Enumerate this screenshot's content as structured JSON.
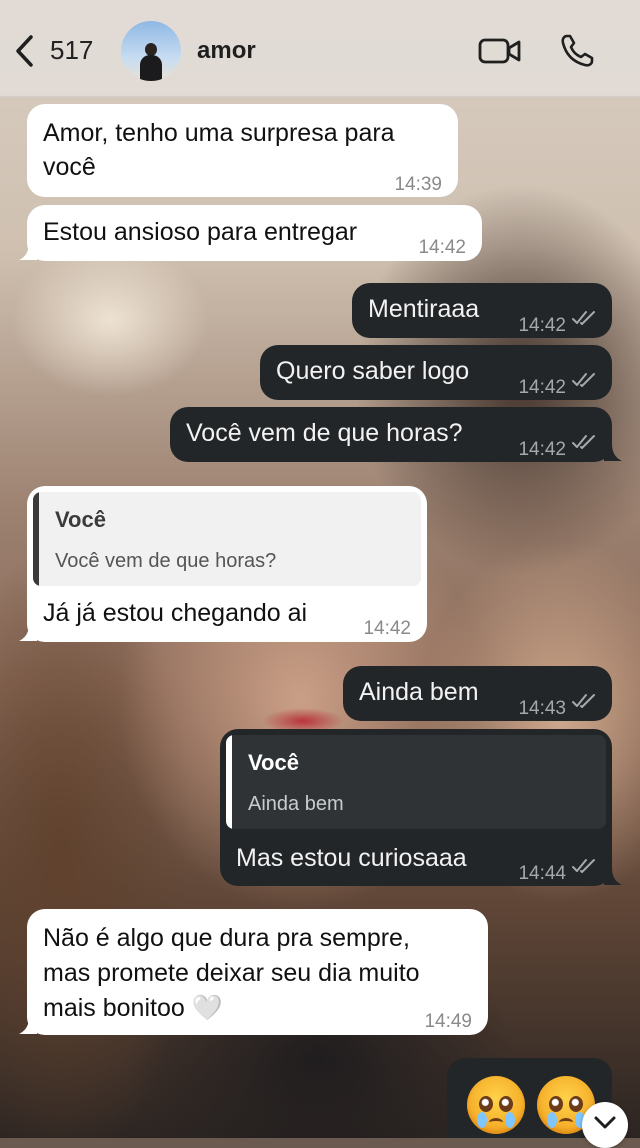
{
  "header": {
    "unread_count": "517",
    "contact_name": "amor"
  },
  "messages": [
    {
      "direction": "in",
      "lines": [
        "Amor, tenho uma surpresa para",
        "você"
      ],
      "time": "14:39"
    },
    {
      "direction": "in",
      "lines": [
        "Estou ansioso para entregar"
      ],
      "time": "14:42"
    },
    {
      "direction": "out",
      "lines": [
        "Mentiraaa"
      ],
      "time": "14:42"
    },
    {
      "direction": "out",
      "lines": [
        "Quero saber logo"
      ],
      "time": "14:42"
    },
    {
      "direction": "out",
      "lines": [
        "Você vem de que horas?"
      ],
      "time": "14:42"
    },
    {
      "direction": "in",
      "quote": {
        "author": "Você",
        "text": "Você vem de que horas?"
      },
      "lines": [
        "Já já estou chegando ai"
      ],
      "time": "14:42"
    },
    {
      "direction": "out",
      "lines": [
        "Ainda bem"
      ],
      "time": "14:43"
    },
    {
      "direction": "out",
      "quote": {
        "author": "Você",
        "text": "Ainda bem"
      },
      "lines": [
        "Mas estou curiosaaa"
      ],
      "time": "14:44"
    },
    {
      "direction": "in",
      "lines": [
        "Não é algo que dura pra sempre,",
        "mas promete deixar seu dia muito",
        "mais bonitoo 🤍"
      ],
      "time": "14:49"
    },
    {
      "direction": "out",
      "emoji": [
        "pleading-face-emoji",
        "pleading-face-emoji"
      ]
    }
  ],
  "colors": {
    "incoming_bubble": "#ffffff",
    "outgoing_bubble": "#232628",
    "header_bg": "#e2dcd6"
  },
  "icons": [
    "back-chevron-icon",
    "video-call-icon",
    "phone-call-icon",
    "read-ticks-icon",
    "scroll-down-chevron-icon"
  ]
}
